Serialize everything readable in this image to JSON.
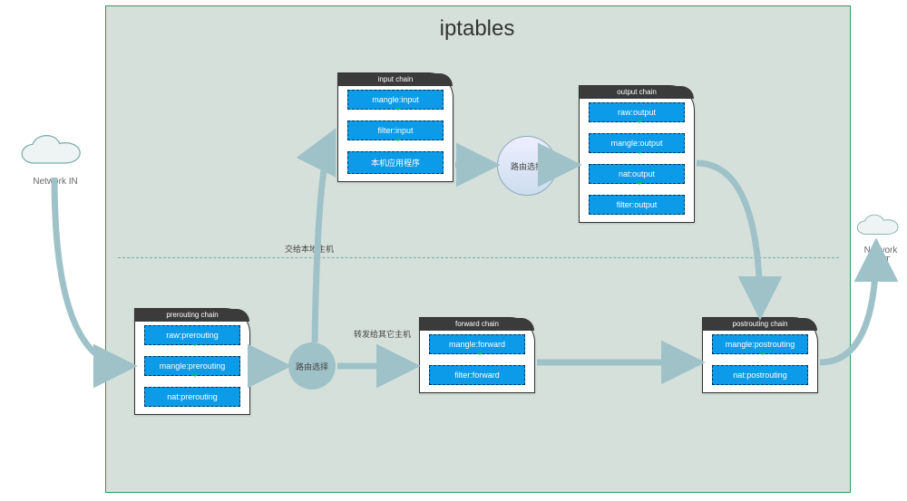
{
  "title": "iptables",
  "network_in": "Network IN",
  "network_out": "Network OUT",
  "route1": "路由选择",
  "route2": "路由选择",
  "note_local": "交给本地主机",
  "note_forward": "转发给其它主机",
  "chains": {
    "prerouting": {
      "title": "prerouting chain",
      "rules": [
        "raw:prerouting",
        "mangle:prerouting",
        "nat:prerouting"
      ]
    },
    "input": {
      "title": "input chain",
      "rules": [
        "mangle:input",
        "filter:input",
        "本机应用程序"
      ]
    },
    "output": {
      "title": "output chain",
      "rules": [
        "raw:output",
        "mangle:output",
        "nat:output",
        "filter:output"
      ]
    },
    "forward": {
      "title": "forward chain",
      "rules": [
        "mangle:forward",
        "filter:forward"
      ]
    },
    "postrouting": {
      "title": "postrouting chain",
      "rules": [
        "mangle:postrouting",
        "nat:postrouting"
      ]
    }
  }
}
